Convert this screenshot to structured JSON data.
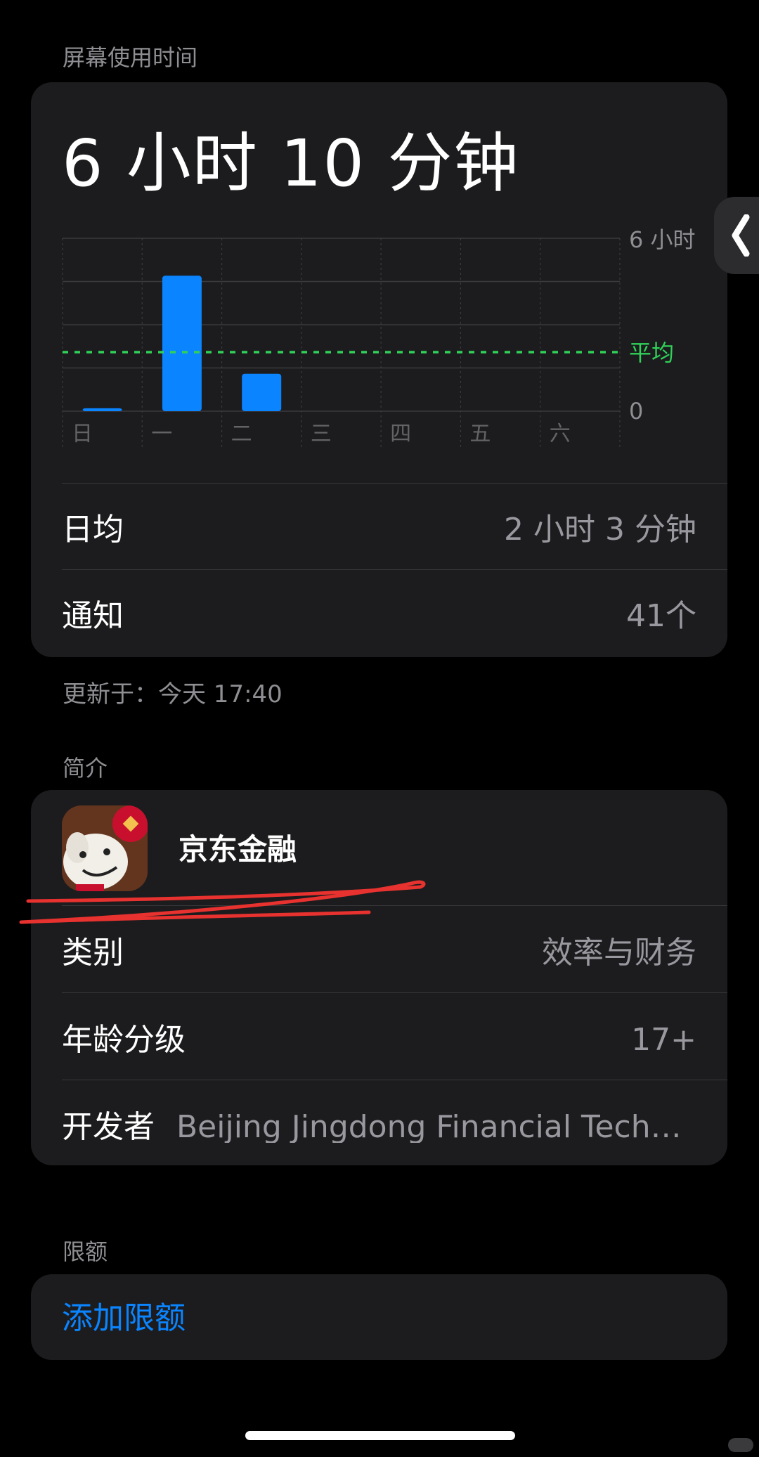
{
  "screen_time": {
    "header": "屏幕使用时间",
    "total": "6 小时 10 分钟",
    "daily_avg_label": "日均",
    "daily_avg_value": "2 小时 3 分钟",
    "notifications_label": "通知",
    "notifications_value": "41个",
    "updated": "更新于：今天 17:40"
  },
  "chart_data": {
    "type": "bar",
    "categories": [
      "日",
      "一",
      "二",
      "三",
      "四",
      "五",
      "六"
    ],
    "values": [
      0.1,
      4.7,
      1.3,
      0,
      0,
      0,
      0
    ],
    "ylim": [
      0,
      6
    ],
    "y_tick_labels": [
      "6 小时",
      "0"
    ],
    "average": 2.05,
    "average_label": "平均",
    "grid": true,
    "bar_color": "#0a84ff",
    "average_color": "#30d158"
  },
  "about": {
    "header": "简介",
    "app_name": "京东金融",
    "category_label": "类别",
    "category_value": "效率与财务",
    "age_label": "年龄分级",
    "age_value": "17+",
    "developer_label": "开发者",
    "developer_value": "Beijing Jingdong Financial Techno..."
  },
  "limits": {
    "header": "限额",
    "add_label": "添加限额"
  },
  "colors": {
    "background": "#000000",
    "card": "#1c1c1e",
    "accent": "#0a84ff",
    "average_line": "#30d158",
    "annotation": "#e8322f"
  },
  "icons": {
    "side_tab": "chevron-left-icon",
    "app": "jd-finance-app-icon"
  }
}
